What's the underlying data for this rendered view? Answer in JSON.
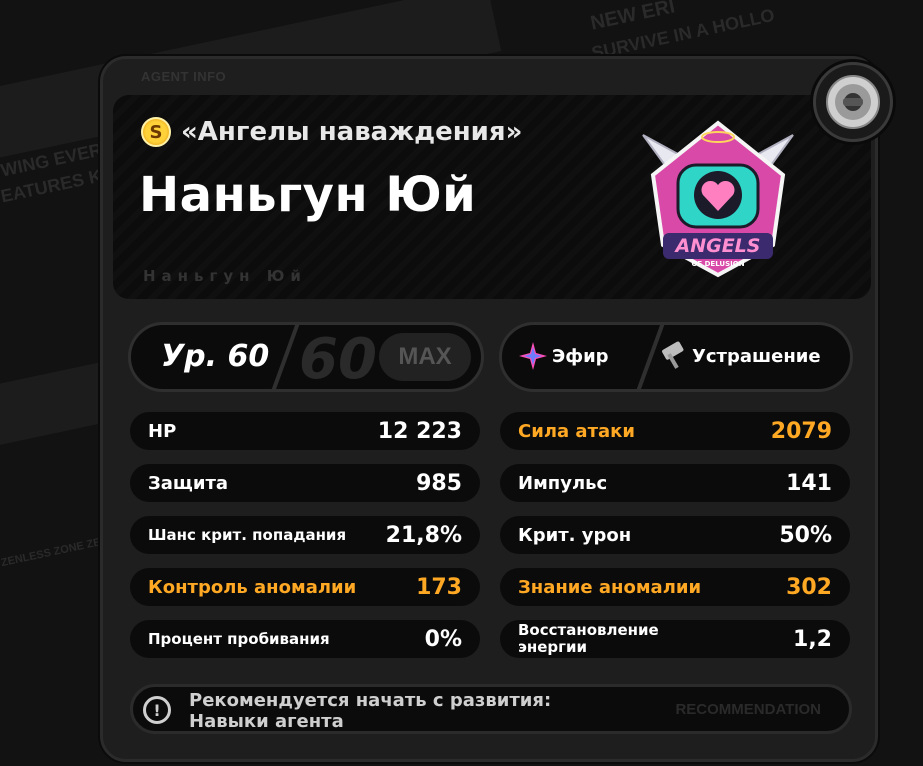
{
  "background": {
    "graffiti_top": "NEW ERI",
    "graffiti_top2": "SURVIVE IN A HOLLO",
    "graffiti_left": "WING EVER",
    "graffiti_left2": "EATURES K",
    "graffiti_zzz": "ZENLESS ZONE ZERO"
  },
  "card": {
    "section_label": "AGENT INFO",
    "faction_rank": "S",
    "faction_name": "«Ангелы наваждения»",
    "agent_name": "Наньгун Юй",
    "agent_subtitle": "Наньгун Юй",
    "emblem_text": "ANGELS",
    "emblem_subtext": "OF DELUSION"
  },
  "level": {
    "label": "Ур. 60",
    "big_number": "60",
    "max_label": "MAX"
  },
  "attributes": [
    {
      "label": "Эфир",
      "icon": "ether-star-icon"
    },
    {
      "label": "Устрашение",
      "icon": "stun-hammer-icon"
    }
  ],
  "stats_left": [
    {
      "label": "HP",
      "value": "12 223",
      "highlight": false
    },
    {
      "label": "Защита",
      "value": "985",
      "highlight": false
    },
    {
      "label": "Шанс крит. попадания",
      "value": "21,8%",
      "highlight": false
    },
    {
      "label": "Контроль аномалии",
      "value": "173",
      "highlight": true
    },
    {
      "label": "Процент пробивания",
      "value": "0%",
      "highlight": false
    }
  ],
  "stats_right": [
    {
      "label": "Сила атаки",
      "value": "2079",
      "highlight": true
    },
    {
      "label": "Импульс",
      "value": "141",
      "highlight": false
    },
    {
      "label": "Крит. урон",
      "value": "50%",
      "highlight": false
    },
    {
      "label": "Знание аномалии",
      "value": "302",
      "highlight": true
    },
    {
      "label": "Восстановление энергии",
      "value": "1,2",
      "highlight": false
    }
  ],
  "recommendation": {
    "line1": "Рекомендуется начать с развития:",
    "line2": "Навыки агента",
    "tag": "RECOMMENDATION"
  },
  "colors": {
    "accent": "#ffa824",
    "panel": "#0b0b0b",
    "card": "#1e1e1e"
  }
}
